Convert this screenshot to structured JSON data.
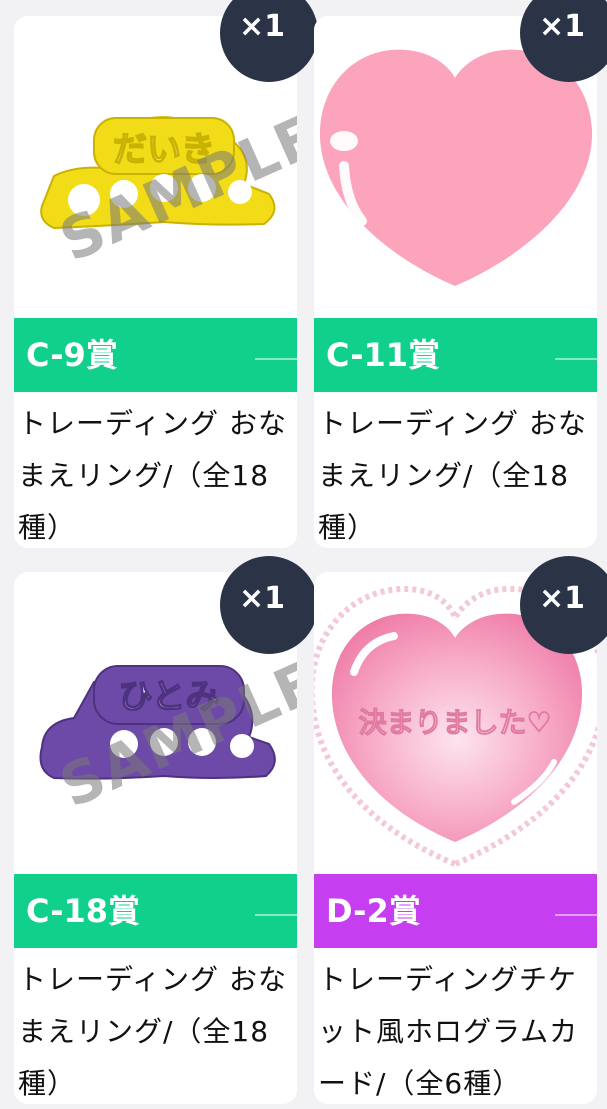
{
  "colors": {
    "green_band": "#11d08c",
    "purple_band": "#c53ef0",
    "badge_bg": "#2b3447",
    "page_bg": "#f2f2f5"
  },
  "cards": [
    {
      "prize": "C-9賞",
      "description": "トレーディング おなまえリング/（全18種）",
      "quantity": "×1",
      "image": {
        "icon": "ring-icon",
        "ring_text": "だいき",
        "watermark": "SAMPLE"
      }
    },
    {
      "prize": "C-11賞",
      "description": "トレーディング おなまえリング/（全18種）",
      "quantity": "×1",
      "image": {
        "icon": "heart-icon"
      }
    },
    {
      "prize": "C-18賞",
      "description": "トレーディング おなまえリング/（全18種）",
      "quantity": "×1",
      "image": {
        "icon": "ring-icon",
        "ring_text": "ひとみ",
        "watermark": "SAMPLE"
      }
    },
    {
      "prize": "D-2賞",
      "description": "トレーディングチケット風ホログラムカード/（全6種）",
      "quantity": "×1",
      "image": {
        "icon": "heart-card-icon",
        "card_text": "決まりました♡"
      }
    }
  ]
}
